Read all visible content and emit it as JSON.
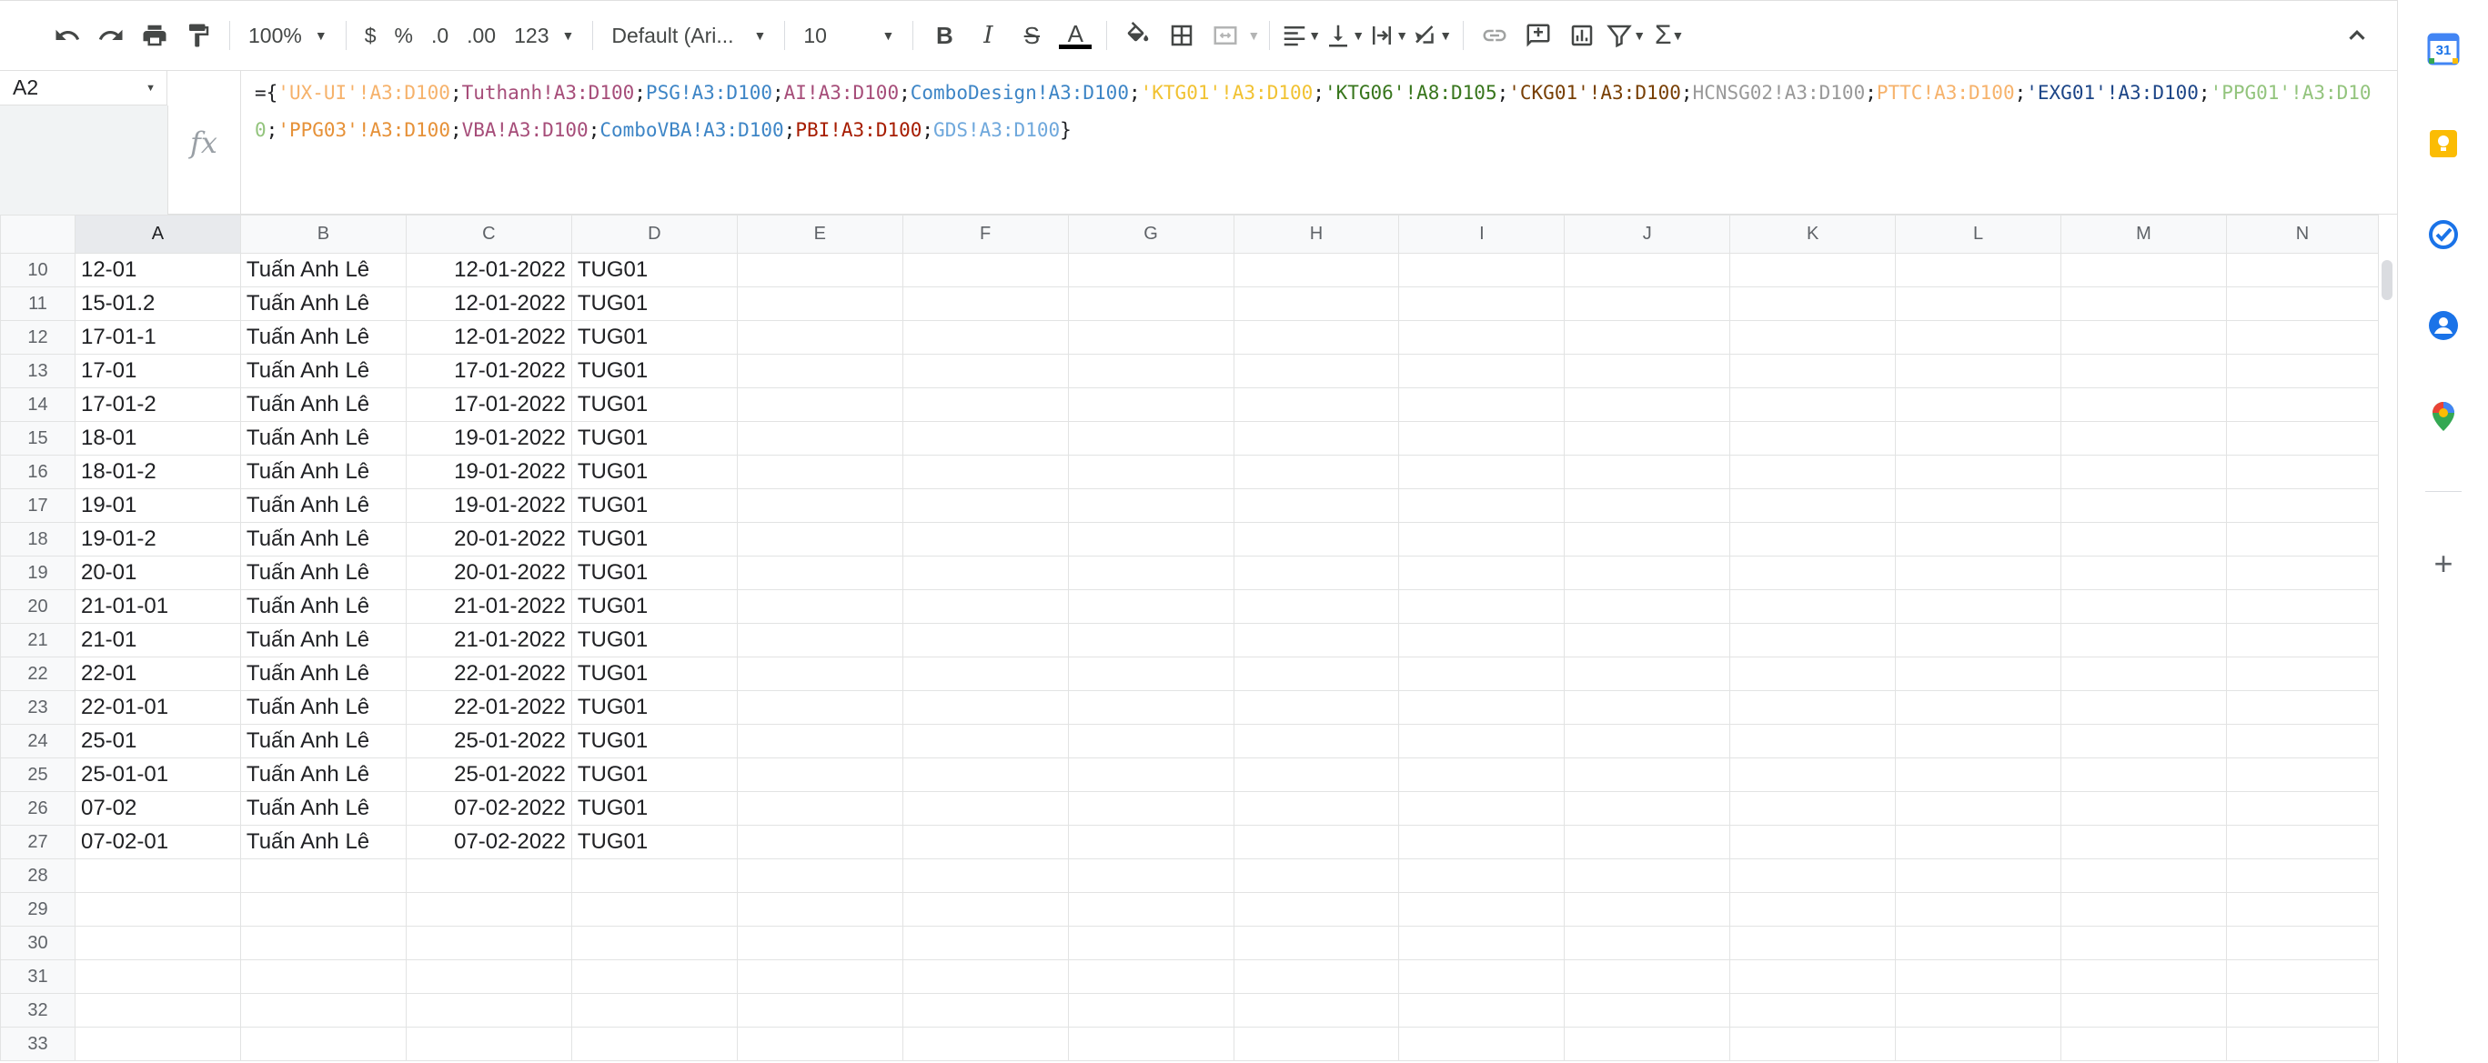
{
  "toolbar": {
    "zoom": "100%",
    "currency": "$",
    "percent": "%",
    "dec_decrease": ".0",
    "dec_increase": ".00",
    "format_more": "123",
    "font": "Default (Ari...",
    "font_size": "10",
    "bold": "B",
    "italic": "I",
    "strike": "S",
    "text_color": "A"
  },
  "namebox": {
    "cell": "A2"
  },
  "formula_tokens": [
    {
      "t": "={",
      "c": "#202124"
    },
    {
      "t": "'UX-UI'!A3:D100",
      "c": "#f6b26b"
    },
    {
      "t": ";",
      "c": "#202124"
    },
    {
      "t": "Tuthanh!A3:D100",
      "c": "#a64d79"
    },
    {
      "t": ";",
      "c": "#202124"
    },
    {
      "t": "PSG!A3:D100",
      "c": "#3d85c6"
    },
    {
      "t": ";",
      "c": "#202124"
    },
    {
      "t": "AI!A3:D100",
      "c": "#a64d79"
    },
    {
      "t": ";",
      "c": "#202124"
    },
    {
      "t": "ComboDesign!A3:D100",
      "c": "#3d85c6"
    },
    {
      "t": ";",
      "c": "#202124"
    },
    {
      "t": "'KTG01'!A3:D100",
      "c": "#f1c232"
    },
    {
      "t": ";",
      "c": "#202124"
    },
    {
      "t": "'KTG06'!A8:D105",
      "c": "#38761d"
    },
    {
      "t": ";",
      "c": "#202124"
    },
    {
      "t": "'CKG01'!A3:D100",
      "c": "#783f04"
    },
    {
      "t": ";",
      "c": "#202124"
    },
    {
      "t": "HCNSG02!A3:D100",
      "c": "#999999"
    },
    {
      "t": ";",
      "c": "#202124"
    },
    {
      "t": "PTTC!A3:D100",
      "c": "#f6b26b"
    },
    {
      "t": ";",
      "c": "#202124"
    },
    {
      "t": "'EXG01'!A3:D100",
      "c": "#1c4587"
    },
    {
      "t": ";",
      "c": "#202124"
    },
    {
      "t": "'PPG01'!A3:D100",
      "c": "#93c47d"
    },
    {
      "t": ";",
      "c": "#202124"
    },
    {
      "t": "'PPG03'!A3:D100",
      "c": "#e69138"
    },
    {
      "t": ";",
      "c": "#202124"
    },
    {
      "t": "VBA!A3:D100",
      "c": "#a64d79"
    },
    {
      "t": ";",
      "c": "#202124"
    },
    {
      "t": "ComboVBA!A3:D100",
      "c": "#3d85c6"
    },
    {
      "t": ";",
      "c": "#202124"
    },
    {
      "t": "PBI!A3:D100",
      "c": "#a61c00"
    },
    {
      "t": ";",
      "c": "#202124"
    },
    {
      "t": "GDS!A3:D100",
      "c": "#6fa8dc"
    },
    {
      "t": "}",
      "c": "#202124"
    }
  ],
  "columns": [
    "A",
    "B",
    "C",
    "D",
    "E",
    "F",
    "G",
    "H",
    "I",
    "J",
    "K",
    "L",
    "M",
    "N"
  ],
  "rows": [
    {
      "n": "10",
      "a": "12-01",
      "b": "Tuấn Anh Lê",
      "c": "12-01-2022",
      "d": "TUG01"
    },
    {
      "n": "11",
      "a": "15-01.2",
      "b": "Tuấn Anh Lê",
      "c": "12-01-2022",
      "d": "TUG01"
    },
    {
      "n": "12",
      "a": "17-01-1",
      "b": "Tuấn Anh Lê",
      "c": "12-01-2022",
      "d": "TUG01"
    },
    {
      "n": "13",
      "a": "17-01",
      "b": "Tuấn Anh Lê",
      "c": "17-01-2022",
      "d": "TUG01"
    },
    {
      "n": "14",
      "a": "17-01-2",
      "b": "Tuấn Anh Lê",
      "c": "17-01-2022",
      "d": "TUG01"
    },
    {
      "n": "15",
      "a": "18-01",
      "b": "Tuấn Anh Lê",
      "c": "19-01-2022",
      "d": "TUG01"
    },
    {
      "n": "16",
      "a": "18-01-2",
      "b": "Tuấn Anh Lê",
      "c": "19-01-2022",
      "d": "TUG01"
    },
    {
      "n": "17",
      "a": "19-01",
      "b": "Tuấn Anh Lê",
      "c": "19-01-2022",
      "d": "TUG01"
    },
    {
      "n": "18",
      "a": "19-01-2",
      "b": "Tuấn Anh Lê",
      "c": "20-01-2022",
      "d": "TUG01"
    },
    {
      "n": "19",
      "a": "20-01",
      "b": "Tuấn Anh Lê",
      "c": "20-01-2022",
      "d": "TUG01"
    },
    {
      "n": "20",
      "a": "21-01-01",
      "b": "Tuấn Anh Lê",
      "c": "21-01-2022",
      "d": "TUG01"
    },
    {
      "n": "21",
      "a": "21-01",
      "b": "Tuấn Anh Lê",
      "c": "21-01-2022",
      "d": "TUG01"
    },
    {
      "n": "22",
      "a": "22-01",
      "b": "Tuấn Anh Lê",
      "c": "22-01-2022",
      "d": "TUG01"
    },
    {
      "n": "23",
      "a": "22-01-01",
      "b": "Tuấn Anh Lê",
      "c": "22-01-2022",
      "d": "TUG01"
    },
    {
      "n": "24",
      "a": "25-01",
      "b": "Tuấn Anh Lê",
      "c": "25-01-2022",
      "d": "TUG01"
    },
    {
      "n": "25",
      "a": "25-01-01",
      "b": "Tuấn Anh Lê",
      "c": "25-01-2022",
      "d": "TUG01"
    },
    {
      "n": "26",
      "a": "07-02",
      "b": "Tuấn Anh Lê",
      "c": "07-02-2022",
      "d": "TUG01"
    },
    {
      "n": "27",
      "a": "07-02-01",
      "b": "Tuấn Anh Lê",
      "c": "07-02-2022",
      "d": "TUG01"
    },
    {
      "n": "28",
      "a": "",
      "b": "",
      "c": "",
      "d": ""
    },
    {
      "n": "29",
      "a": "",
      "b": "",
      "c": "",
      "d": ""
    },
    {
      "n": "30",
      "a": "",
      "b": "",
      "c": "",
      "d": ""
    },
    {
      "n": "31",
      "a": "",
      "b": "",
      "c": "",
      "d": ""
    },
    {
      "n": "32",
      "a": "",
      "b": "",
      "c": "",
      "d": ""
    },
    {
      "n": "33",
      "a": "",
      "b": "",
      "c": "",
      "d": ""
    }
  ],
  "side_panel": {
    "calendar_day": "31",
    "icons": [
      "calendar-icon",
      "keep-icon",
      "tasks-icon",
      "contacts-icon",
      "maps-icon",
      "add-icon"
    ]
  }
}
